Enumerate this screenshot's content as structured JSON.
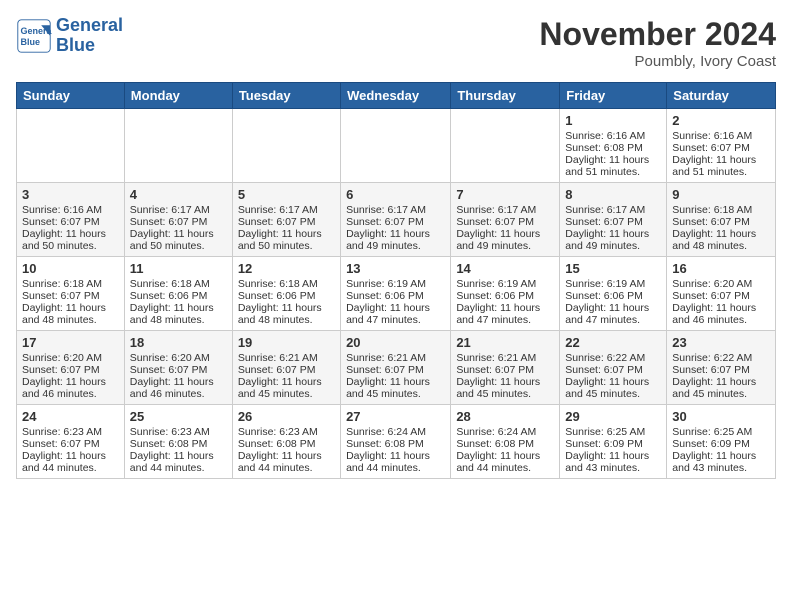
{
  "logo": {
    "text_line1": "General",
    "text_line2": "Blue"
  },
  "header": {
    "month": "November 2024",
    "location": "Poumbly, Ivory Coast"
  },
  "weekdays": [
    "Sunday",
    "Monday",
    "Tuesday",
    "Wednesday",
    "Thursday",
    "Friday",
    "Saturday"
  ],
  "weeks": [
    [
      {
        "day": "",
        "info": ""
      },
      {
        "day": "",
        "info": ""
      },
      {
        "day": "",
        "info": ""
      },
      {
        "day": "",
        "info": ""
      },
      {
        "day": "",
        "info": ""
      },
      {
        "day": "1",
        "sunrise": "Sunrise: 6:16 AM",
        "sunset": "Sunset: 6:08 PM",
        "daylight": "Daylight: 11 hours and 51 minutes."
      },
      {
        "day": "2",
        "sunrise": "Sunrise: 6:16 AM",
        "sunset": "Sunset: 6:07 PM",
        "daylight": "Daylight: 11 hours and 51 minutes."
      }
    ],
    [
      {
        "day": "3",
        "sunrise": "Sunrise: 6:16 AM",
        "sunset": "Sunset: 6:07 PM",
        "daylight": "Daylight: 11 hours and 50 minutes."
      },
      {
        "day": "4",
        "sunrise": "Sunrise: 6:17 AM",
        "sunset": "Sunset: 6:07 PM",
        "daylight": "Daylight: 11 hours and 50 minutes."
      },
      {
        "day": "5",
        "sunrise": "Sunrise: 6:17 AM",
        "sunset": "Sunset: 6:07 PM",
        "daylight": "Daylight: 11 hours and 50 minutes."
      },
      {
        "day": "6",
        "sunrise": "Sunrise: 6:17 AM",
        "sunset": "Sunset: 6:07 PM",
        "daylight": "Daylight: 11 hours and 49 minutes."
      },
      {
        "day": "7",
        "sunrise": "Sunrise: 6:17 AM",
        "sunset": "Sunset: 6:07 PM",
        "daylight": "Daylight: 11 hours and 49 minutes."
      },
      {
        "day": "8",
        "sunrise": "Sunrise: 6:17 AM",
        "sunset": "Sunset: 6:07 PM",
        "daylight": "Daylight: 11 hours and 49 minutes."
      },
      {
        "day": "9",
        "sunrise": "Sunrise: 6:18 AM",
        "sunset": "Sunset: 6:07 PM",
        "daylight": "Daylight: 11 hours and 48 minutes."
      }
    ],
    [
      {
        "day": "10",
        "sunrise": "Sunrise: 6:18 AM",
        "sunset": "Sunset: 6:07 PM",
        "daylight": "Daylight: 11 hours and 48 minutes."
      },
      {
        "day": "11",
        "sunrise": "Sunrise: 6:18 AM",
        "sunset": "Sunset: 6:06 PM",
        "daylight": "Daylight: 11 hours and 48 minutes."
      },
      {
        "day": "12",
        "sunrise": "Sunrise: 6:18 AM",
        "sunset": "Sunset: 6:06 PM",
        "daylight": "Daylight: 11 hours and 48 minutes."
      },
      {
        "day": "13",
        "sunrise": "Sunrise: 6:19 AM",
        "sunset": "Sunset: 6:06 PM",
        "daylight": "Daylight: 11 hours and 47 minutes."
      },
      {
        "day": "14",
        "sunrise": "Sunrise: 6:19 AM",
        "sunset": "Sunset: 6:06 PM",
        "daylight": "Daylight: 11 hours and 47 minutes."
      },
      {
        "day": "15",
        "sunrise": "Sunrise: 6:19 AM",
        "sunset": "Sunset: 6:06 PM",
        "daylight": "Daylight: 11 hours and 47 minutes."
      },
      {
        "day": "16",
        "sunrise": "Sunrise: 6:20 AM",
        "sunset": "Sunset: 6:07 PM",
        "daylight": "Daylight: 11 hours and 46 minutes."
      }
    ],
    [
      {
        "day": "17",
        "sunrise": "Sunrise: 6:20 AM",
        "sunset": "Sunset: 6:07 PM",
        "daylight": "Daylight: 11 hours and 46 minutes."
      },
      {
        "day": "18",
        "sunrise": "Sunrise: 6:20 AM",
        "sunset": "Sunset: 6:07 PM",
        "daylight": "Daylight: 11 hours and 46 minutes."
      },
      {
        "day": "19",
        "sunrise": "Sunrise: 6:21 AM",
        "sunset": "Sunset: 6:07 PM",
        "daylight": "Daylight: 11 hours and 45 minutes."
      },
      {
        "day": "20",
        "sunrise": "Sunrise: 6:21 AM",
        "sunset": "Sunset: 6:07 PM",
        "daylight": "Daylight: 11 hours and 45 minutes."
      },
      {
        "day": "21",
        "sunrise": "Sunrise: 6:21 AM",
        "sunset": "Sunset: 6:07 PM",
        "daylight": "Daylight: 11 hours and 45 minutes."
      },
      {
        "day": "22",
        "sunrise": "Sunrise: 6:22 AM",
        "sunset": "Sunset: 6:07 PM",
        "daylight": "Daylight: 11 hours and 45 minutes."
      },
      {
        "day": "23",
        "sunrise": "Sunrise: 6:22 AM",
        "sunset": "Sunset: 6:07 PM",
        "daylight": "Daylight: 11 hours and 45 minutes."
      }
    ],
    [
      {
        "day": "24",
        "sunrise": "Sunrise: 6:23 AM",
        "sunset": "Sunset: 6:07 PM",
        "daylight": "Daylight: 11 hours and 44 minutes."
      },
      {
        "day": "25",
        "sunrise": "Sunrise: 6:23 AM",
        "sunset": "Sunset: 6:08 PM",
        "daylight": "Daylight: 11 hours and 44 minutes."
      },
      {
        "day": "26",
        "sunrise": "Sunrise: 6:23 AM",
        "sunset": "Sunset: 6:08 PM",
        "daylight": "Daylight: 11 hours and 44 minutes."
      },
      {
        "day": "27",
        "sunrise": "Sunrise: 6:24 AM",
        "sunset": "Sunset: 6:08 PM",
        "daylight": "Daylight: 11 hours and 44 minutes."
      },
      {
        "day": "28",
        "sunrise": "Sunrise: 6:24 AM",
        "sunset": "Sunset: 6:08 PM",
        "daylight": "Daylight: 11 hours and 44 minutes."
      },
      {
        "day": "29",
        "sunrise": "Sunrise: 6:25 AM",
        "sunset": "Sunset: 6:09 PM",
        "daylight": "Daylight: 11 hours and 43 minutes."
      },
      {
        "day": "30",
        "sunrise": "Sunrise: 6:25 AM",
        "sunset": "Sunset: 6:09 PM",
        "daylight": "Daylight: 11 hours and 43 minutes."
      }
    ]
  ]
}
